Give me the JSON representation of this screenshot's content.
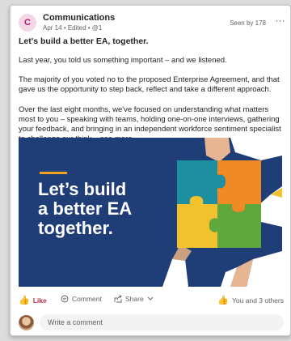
{
  "post": {
    "author_initial": "C",
    "author": "Communications",
    "date": "Apr 14",
    "edited": "Edited",
    "at_count": "@1",
    "seen_by": "Seen by 178",
    "more": "···",
    "title": "Let's build a better EA, together.",
    "paragraphs": [
      "Last year, you told us something important – and we listened.",
      "The majority of you voted no to the proposed Enterprise Agreement, and that gave us the opportunity to step back, reflect and take a different approach.",
      "Over the last eight months, we've focused on understanding what matters most to you – speaking with teams, holding one-on-one interviews, gathering your feedback, and bringing in an independent workforce sentiment specialist to challenge our think..."
    ],
    "see_more": "see more"
  },
  "banner": {
    "lines": [
      "Let’s build",
      "a better EA",
      "together."
    ],
    "colors": {
      "background": "#1f3e78",
      "accent_line": "#f3a21b",
      "puzzle_teal": "#1e8fa0",
      "puzzle_orange": "#f08a24",
      "puzzle_yellow": "#f2c22e",
      "puzzle_green": "#5fa83d"
    }
  },
  "actions": {
    "like": "Like",
    "comment": "Comment",
    "share": "Share",
    "reactions": "You and 3 others"
  },
  "comment_box": {
    "placeholder": "Write a comment"
  },
  "icons": {
    "like": "thumbs-up-icon",
    "comment": "comment-bubble-icon",
    "share": "share-icon",
    "share_dropdown": "chevron-down-icon",
    "more": "ellipsis-icon"
  }
}
